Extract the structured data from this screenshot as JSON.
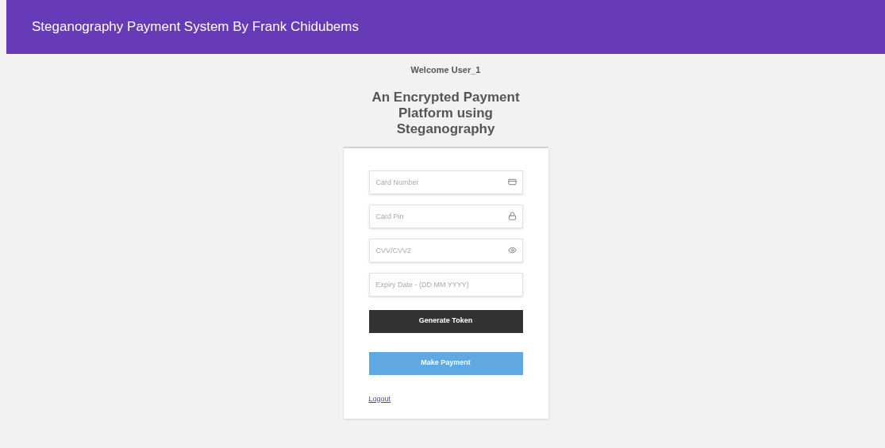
{
  "header": {
    "title": "Steganography Payment System By Frank Chidubems"
  },
  "welcome": "Welcome User_1",
  "heading": "An Encrypted Payment Platform using Steganography",
  "fields": [
    {
      "placeholder": "Card Number",
      "kind": "card"
    },
    {
      "placeholder": "Card Pin",
      "kind": "lock"
    },
    {
      "placeholder": "CVV/CVV2",
      "kind": "eye"
    },
    {
      "placeholder": "Expiry Date - (DD MM YYYY)",
      "kind": "none"
    }
  ],
  "buttons": [
    {
      "label": "Generate Token",
      "kind": "dark"
    },
    {
      "label": "Make Payment",
      "kind": "primary"
    }
  ],
  "logout": "Logout"
}
